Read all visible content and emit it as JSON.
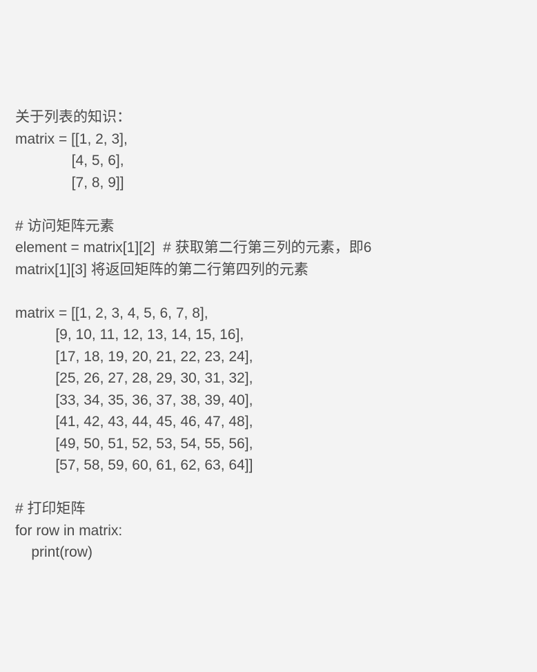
{
  "lines": {
    "l0": "关于列表的知识：",
    "l1": "matrix = [[1, 2, 3],",
    "l2": "              [4, 5, 6],",
    "l3": "              [7, 8, 9]]",
    "l4": "",
    "l5": "# 访问矩阵元素",
    "l6": "element = matrix[1][2]  # 获取第二行第三列的元素，即6",
    "l7": "matrix[1][3] 将返回矩阵的第二行第四列的元素",
    "l8": "",
    "l9": "matrix = [[1, 2, 3, 4, 5, 6, 7, 8],",
    "l10": "          [9, 10, 11, 12, 13, 14, 15, 16],",
    "l11": "          [17, 18, 19, 20, 21, 22, 23, 24],",
    "l12": "          [25, 26, 27, 28, 29, 30, 31, 32],",
    "l13": "          [33, 34, 35, 36, 37, 38, 39, 40],",
    "l14": "          [41, 42, 43, 44, 45, 46, 47, 48],",
    "l15": "          [49, 50, 51, 52, 53, 54, 55, 56],",
    "l16": "          [57, 58, 59, 60, 61, 62, 63, 64]]",
    "l17": "",
    "l18": "# 打印矩阵",
    "l19": "for row in matrix:",
    "l20": "    print(row)"
  }
}
